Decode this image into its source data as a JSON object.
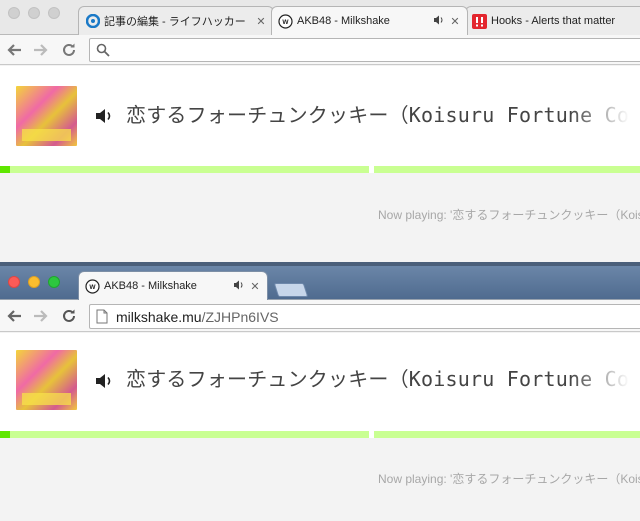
{
  "window1": {
    "tabs": [
      {
        "title": "記事の編集 - ライフハッカー［日本版］",
        "favicon": "lifehacker-icon",
        "active": false
      },
      {
        "title": "AKB48 - Milkshake",
        "favicon": "milkshake-icon",
        "active": true,
        "audio": true
      },
      {
        "title": "Hooks - Alerts that matter",
        "favicon": "hooks-icon",
        "active": false
      }
    ],
    "address": {
      "host": "",
      "path": "",
      "placeholder": ""
    },
    "player": {
      "song_title": "恋するフォーチュンクッキー（Koisuru Fortune Cookie）",
      "now_playing": "Now playing: '恋するフォーチュンクッキー（Koisuru Fortune Cookie）'",
      "progress": 0.015
    }
  },
  "window2": {
    "tabs": [
      {
        "title": "AKB48 - Milkshake",
        "favicon": "milkshake-icon",
        "active": true,
        "audio": true
      }
    ],
    "address": {
      "host": "milkshake.mu",
      "path": "/ZJHPn6IVS"
    },
    "player": {
      "song_title": "恋するフォーチュンクッキー（Koisuru Fortune Cookie）",
      "now_playing": "Now playing: '恋するフォーチュンクッキー（Koisuru Fortune Cookie）'",
      "progress": 0.015
    }
  },
  "colors": {
    "progress_track": "#c9ff92",
    "progress_fill": "#5fe600",
    "titlebar_active": "#5b779b"
  }
}
